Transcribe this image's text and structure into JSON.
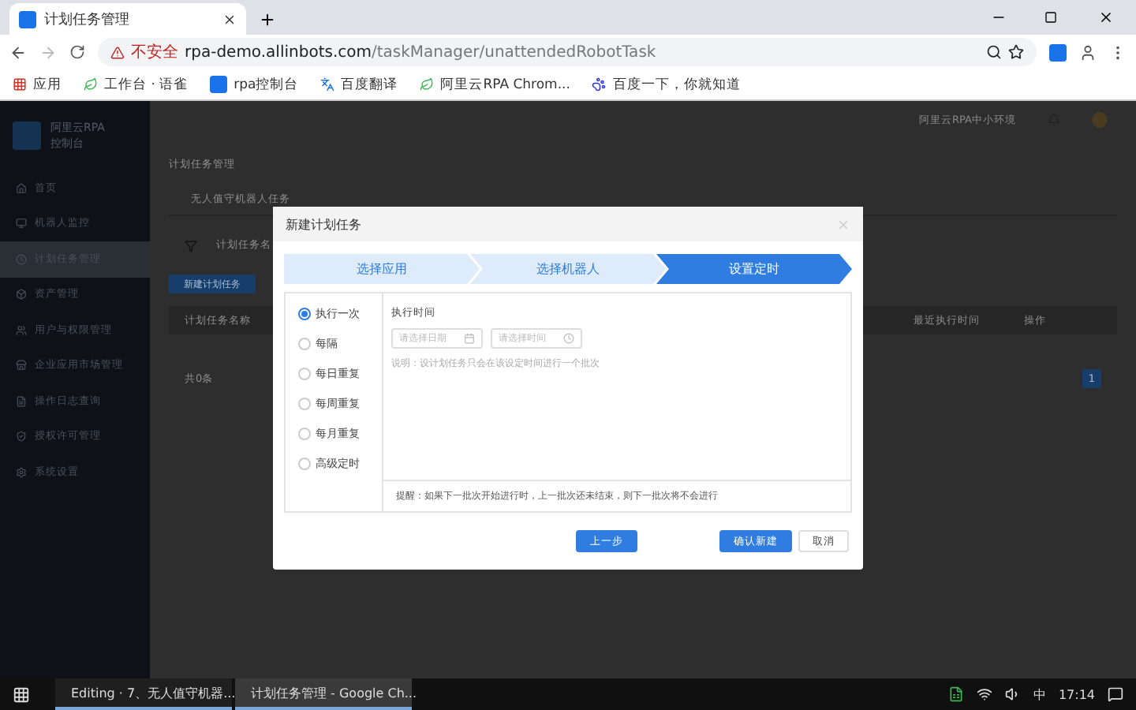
{
  "browser": {
    "tab_title": "计划任务管理",
    "url_warning": "不安全",
    "url_host": "rpa-demo.allinbots.com",
    "url_path": "/taskManager/unattendedRobotTask",
    "bookmarks": [
      {
        "label": "应用",
        "kind": "apps"
      },
      {
        "label": "工作台 · 语雀",
        "kind": "leaf"
      },
      {
        "label": "rpa控制台",
        "kind": "logo"
      },
      {
        "label": "百度翻译",
        "kind": "translate"
      },
      {
        "label": "阿里云RPA Chrom...",
        "kind": "leaf"
      },
      {
        "label": "百度一下，你就知道",
        "kind": "paw"
      }
    ]
  },
  "app": {
    "brand": "阿里云RPA",
    "brand_sub": "控制台",
    "env": "阿里云RPA中小环境",
    "sidebar": [
      {
        "label": "首页",
        "selected": false
      },
      {
        "label": "机器人监控",
        "selected": false
      },
      {
        "label": "计划任务管理",
        "selected": true
      },
      {
        "label": "资产管理",
        "selected": false
      },
      {
        "label": "用户与权限管理",
        "selected": false
      },
      {
        "label": "企业应用市场管理",
        "selected": false
      },
      {
        "label": "操作日志查询",
        "selected": false
      },
      {
        "label": "授权许可管理",
        "selected": false
      },
      {
        "label": "系统设置",
        "selected": false
      }
    ],
    "page_title": "计划任务管理",
    "tab": "无人值守机器人任务",
    "filter": "计划任务名",
    "new_button": "新建计划任务",
    "columns": [
      "计划任务名称",
      "最近执行时间",
      "操作"
    ],
    "total": "共0条",
    "page": "1"
  },
  "dialog": {
    "title": "新建计划任务",
    "steps": [
      {
        "label": "选择应用",
        "selected": false
      },
      {
        "label": "选择机器人",
        "selected": false
      },
      {
        "label": "设置定时",
        "selected": true
      }
    ],
    "options": [
      {
        "label": "执行一次",
        "selected": true
      },
      {
        "label": "每隔",
        "selected": false
      },
      {
        "label": "每日重复",
        "selected": false
      },
      {
        "label": "每周重复",
        "selected": false
      },
      {
        "label": "每月重复",
        "selected": false
      },
      {
        "label": "高级定时",
        "selected": false
      }
    ],
    "field_label": "执行时间",
    "date_placeholder": "请选择日期",
    "time_placeholder": "请选择时间",
    "note": "说明：设计划任务只会在该设定时间进行一个批次",
    "tip": "提醒：如果下一批次开始进行时，上一批次还未结束，则下一批次将不会进行",
    "prev_button": "上一步",
    "confirm_button": "确认新建",
    "cancel_button": "取消"
  },
  "taskbar": {
    "windows": [
      {
        "label": "Editing · 7、无人值守机器...",
        "selected": false
      },
      {
        "label": "计划任务管理 - Google Ch...",
        "selected": true
      }
    ],
    "ime": "中",
    "time": "17:14"
  }
}
